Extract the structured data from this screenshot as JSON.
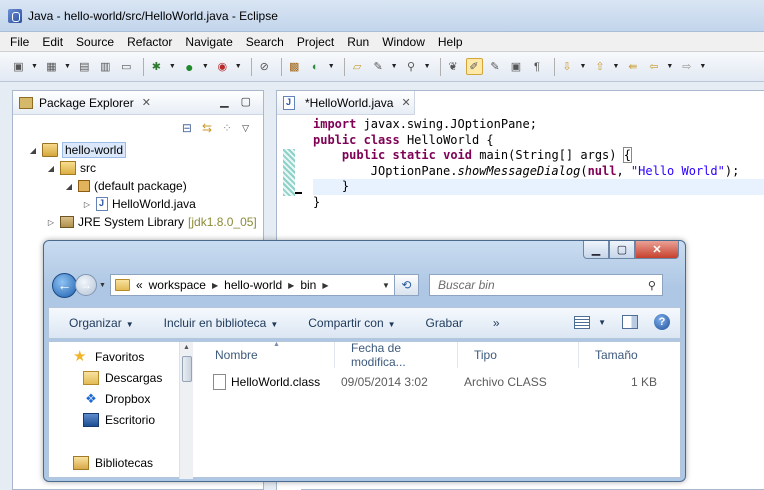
{
  "eclipse": {
    "title": "Java - hello-world/src/HelloWorld.java - Eclipse",
    "menu": [
      "File",
      "Edit",
      "Source",
      "Refactor",
      "Navigate",
      "Search",
      "Project",
      "Run",
      "Window",
      "Help"
    ]
  },
  "package_explorer": {
    "tab_label": "Package Explorer",
    "tree": {
      "project": "hello-world",
      "src": "src",
      "package": "(default package)",
      "file": "HelloWorld.java",
      "jre": "JRE System Library",
      "jre_version": "[jdk1.8.0_05]"
    }
  },
  "editor": {
    "tab_label": "*HelloWorld.java",
    "code": {
      "l1_kw": "import",
      "l1_rest": " javax.swing.JOptionPane;",
      "l2_kw1": "public",
      "l2_kw2": "class",
      "l2_rest": " HelloWorld {",
      "l3_indent": "    ",
      "l3_kw1": "public",
      "l3_kw2": "static",
      "l3_kw3": "void",
      "l3_rest": " main(String[] args) ",
      "l3_brace": "{",
      "l4_indent": "        JOptionPane.",
      "l4_method": "showMessageDialog",
      "l4_open": "(",
      "l4_null": "null",
      "l4_comma": ", ",
      "l4_str": "\"Hello World\"",
      "l4_close": ");",
      "l5": "    }",
      "l6": "}"
    }
  },
  "explorer": {
    "breadcrumb": [
      "«",
      "workspace",
      "hello-world",
      "bin"
    ],
    "search_placeholder": "Buscar bin",
    "commands": [
      "Organizar",
      "Incluir en biblioteca",
      "Compartir con",
      "Grabar",
      "»"
    ],
    "nav": [
      "Favoritos",
      "Descargas",
      "Dropbox",
      "Escritorio",
      "Bibliotecas"
    ],
    "columns": [
      "Nombre",
      "Fecha de modifica...",
      "Tipo",
      "Tamaño"
    ],
    "files": [
      {
        "name": "HelloWorld.class",
        "date": "09/05/2014 3:02",
        "type": "Archivo CLASS",
        "size": "1 KB"
      }
    ]
  }
}
